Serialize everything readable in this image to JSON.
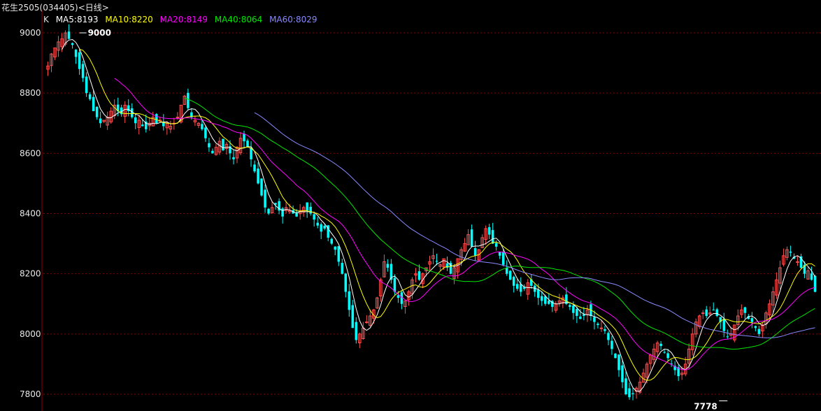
{
  "title": "花生2505(034405)<日线>",
  "legend": {
    "k_label": "K",
    "items": [
      {
        "label": "MA5:8193",
        "color": "#ffffff"
      },
      {
        "label": "MA10:8220",
        "color": "#ffff00"
      },
      {
        "label": "MA20:8149",
        "color": "#ff00ff"
      },
      {
        "label": "MA40:8064",
        "color": "#00e600"
      },
      {
        "label": "MA60:8029",
        "color": "#8888ff"
      }
    ]
  },
  "colors": {
    "up": "#ff5050",
    "down": "#00ffff",
    "grid": "#8b0000",
    "axis": "#8b0000"
  },
  "chart_data": {
    "type": "candlestick",
    "ylim": [
      7790,
      9030
    ],
    "yticks": [
      7800,
      8000,
      8200,
      8400,
      8600,
      8800,
      9000
    ],
    "grid": "dotted-horizontal",
    "annotations": [
      {
        "text": "9000",
        "value": 9000,
        "bar": 9
      },
      {
        "text": "7778",
        "value": 7778,
        "bar": 194
      }
    ],
    "closes": [
      8890,
      8930,
      8950,
      8970,
      8980,
      9000,
      8980,
      8960,
      8920,
      8880,
      8850,
      8800,
      8780,
      8740,
      8720,
      8700,
      8710,
      8720,
      8740,
      8760,
      8740,
      8730,
      8760,
      8740,
      8720,
      8700,
      8710,
      8690,
      8680,
      8700,
      8720,
      8700,
      8710,
      8690,
      8700,
      8690,
      8700,
      8720,
      8760,
      8790,
      8750,
      8720,
      8710,
      8700,
      8680,
      8650,
      8620,
      8600,
      8620,
      8640,
      8610,
      8630,
      8600,
      8580,
      8620,
      8650,
      8640,
      8620,
      8580,
      8540,
      8500,
      8460,
      8420,
      8400,
      8420,
      8430,
      8410,
      8390,
      8420,
      8410,
      8400,
      8390,
      8410,
      8420,
      8410,
      8400,
      8380,
      8360,
      8340,
      8350,
      8320,
      8300,
      8280,
      8240,
      8200,
      8140,
      8080,
      8020,
      7980,
      8000,
      8020,
      8040,
      8060,
      8080,
      8120,
      8180,
      8240,
      8220,
      8180,
      8140,
      8120,
      8100,
      8110,
      8140,
      8180,
      8200,
      8180,
      8200,
      8220,
      8240,
      8260,
      8240,
      8230,
      8250,
      8220,
      8200,
      8220,
      8250,
      8280,
      8300,
      8330,
      8290,
      8260,
      8280,
      8320,
      8350,
      8330,
      8300,
      8290,
      8260,
      8230,
      8200,
      8180,
      8160,
      8150,
      8140,
      8150,
      8170,
      8160,
      8140,
      8120,
      8110,
      8100,
      8100,
      8090,
      8100,
      8110,
      8120,
      8100,
      8090,
      8070,
      8060,
      8050,
      8060,
      8080,
      8060,
      8040,
      8030,
      8020,
      8010,
      7980,
      7950,
      7920,
      7880,
      7840,
      7800,
      7790,
      7800,
      7820,
      7840,
      7870,
      7900,
      7930,
      7950,
      7970,
      7960,
      7940,
      7920,
      7900,
      7880,
      7860,
      7870,
      7900,
      7950,
      8000,
      8040,
      8060,
      8070,
      8060,
      8070,
      8080,
      8060,
      8040,
      8010,
      7990,
      8000,
      8030,
      8060,
      8080,
      8070,
      8050,
      8040,
      8020,
      8000,
      8030,
      8070,
      8100,
      8140,
      8180,
      8220,
      8260,
      8280,
      8270,
      8250,
      8240,
      8220,
      8200,
      8210,
      8180,
      8140
    ]
  }
}
